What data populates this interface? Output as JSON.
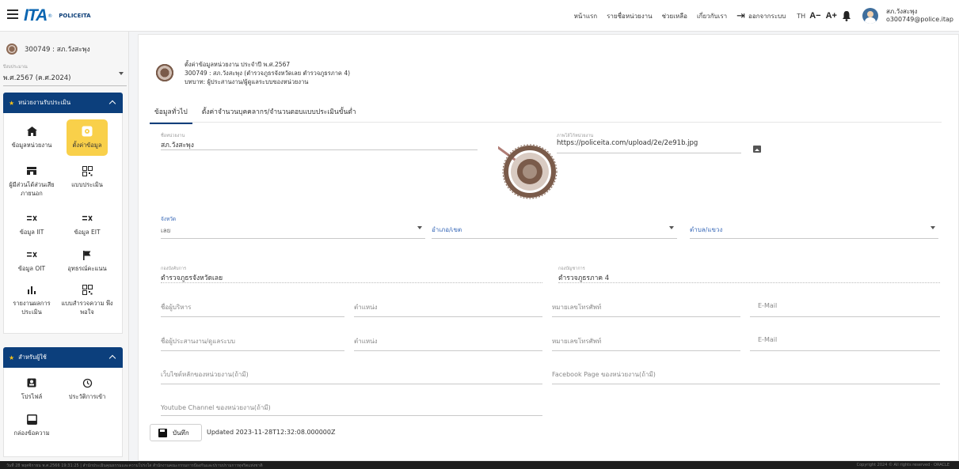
{
  "header": {
    "logo_text": "POLICEITA",
    "nav": [
      "หน้าแรก",
      "รายชื่อหน่วยงาน",
      "ช่วยเหลือ",
      "เกี่ยวกับเรา"
    ],
    "logout": "ออกจากระบบ",
    "lang": "TH",
    "font_minus": "A−",
    "font_plus": "A+",
    "user_name": "สภ.วังสะพุง",
    "user_email": "o300749@police.itap"
  },
  "sidebar": {
    "org": "300749 : สภ.วังสะพุง",
    "year_label": "ปีงบประมาณ",
    "year_value": "พ.ศ.2567 (ค.ศ.2024)",
    "section1": {
      "title": "หน่วยงานรับประเมิน",
      "items": [
        {
          "label": "ข้อมูลหน่วยงาน",
          "icon": "home-icon"
        },
        {
          "label": "ตั้งค่าข้อมูล",
          "icon": "settings-icon"
        },
        {
          "label": "ผู้มีส่วนได้ส่วนเสีย ภายนอก",
          "icon": "stakeholder-icon"
        },
        {
          "label": "แบบประเมิน",
          "icon": "qr-icon"
        },
        {
          "label": "ข้อมูล IIT",
          "icon": "iit-icon"
        },
        {
          "label": "ข้อมูล EIT",
          "icon": "eit-icon"
        },
        {
          "label": "ข้อมูล OIT",
          "icon": "oit-icon"
        },
        {
          "label": "อุทธรณ์คะแนน",
          "icon": "flag-icon"
        },
        {
          "label": "รายงานผลการ ประเมิน",
          "icon": "bar-chart-icon"
        },
        {
          "label": "แบบสำรวจความ พึงพอใจ",
          "icon": "survey-icon"
        }
      ]
    },
    "section2": {
      "title": "สำหรับผู้ใช้",
      "items": [
        {
          "label": "โปรไฟล์",
          "icon": "profile-icon"
        },
        {
          "label": "ประวัติการเข้า",
          "icon": "history-icon"
        },
        {
          "label": "กล่องข้อความ",
          "icon": "inbox-icon"
        }
      ]
    }
  },
  "main": {
    "head_line1": "ตั้งค่าข้อมูลหน่วยงาน ประจำปี พ.ศ.2567",
    "head_line2": "300749 : สภ.วังสะพุง (ตำรวจภูธรจังหวัดเลย ตำรวจภูธรภาค 4)",
    "head_line3": "บทบาท: ผู้ประสานงาน/ผู้ดูแลระบบของหน่วยงาน",
    "tabs": [
      "ข้อมูลทั่วไป",
      "ตั้งค่าจำนวนบุคคลากร/จำนวนตอบแบบประเมินขั้นต่ำ"
    ],
    "fields": {
      "org_name": {
        "label": "ชื่อหน่วยงาน",
        "value": "สภ.วังสะพุง"
      },
      "image": {
        "label": "ภาพโล้โก้หน่วยงาน",
        "value": "https://policeita.com/upload/2e/2e91b.jpg"
      },
      "province": {
        "label": "จังหวัด",
        "value": "เลย"
      },
      "district": {
        "placeholder": "อำเภอ/เขต"
      },
      "subdistrict": {
        "placeholder": "ตำบล/แขวง"
      },
      "superior": {
        "label": "กองบังคับการ",
        "value": "ตำรวจภูธรจังหวัดเลย"
      },
      "command": {
        "label": "กองบัญชาการ",
        "value": "ตำรวจภูธรภาค 4"
      },
      "exec_name": {
        "placeholder": "ชื่อผู้บริหาร"
      },
      "exec_pos": {
        "placeholder": "ตำแหน่ง"
      },
      "exec_phone": {
        "placeholder": "หมายเลขโทรศัพท์"
      },
      "exec_email": {
        "placeholder": "E-Mail"
      },
      "coord_name": {
        "placeholder": "ชื่อผู้ประสานงาน/ดูแลระบบ"
      },
      "coord_pos": {
        "placeholder": "ตำแหน่ง"
      },
      "coord_phone": {
        "placeholder": "หมายเลขโทรศัพท์"
      },
      "coord_email": {
        "placeholder": "E-Mail"
      },
      "website": {
        "placeholder": "เว็บไซต์หลักของหน่วยงาน(ถ้ามี)"
      },
      "facebook": {
        "placeholder": "Facebook Page ของหน่วยงาน(ถ้ามี)"
      },
      "youtube": {
        "placeholder": "Youtube Channel ของหน่วยงาน(ถ้ามี)"
      }
    },
    "save_label": "บันทึก",
    "updated": "Updated 2023-11-28T12:32:08.000000Z"
  },
  "footer": {
    "left": "วันที่ 28 พฤศจิกายน พ.ศ.2566 19:31:25 | สำนักประเมินคุณธรรมและความโปร่งใส สำนักงานคณะกรรมการป้องกันและปราบปรามการทุจริตแห่งชาติ",
    "right": "Copyright 2024 © All rights reserved · ORACLE"
  },
  "colors": {
    "primary": "#0c3f7c",
    "accent": "#f9d04a",
    "brand": "#0a65b1"
  }
}
